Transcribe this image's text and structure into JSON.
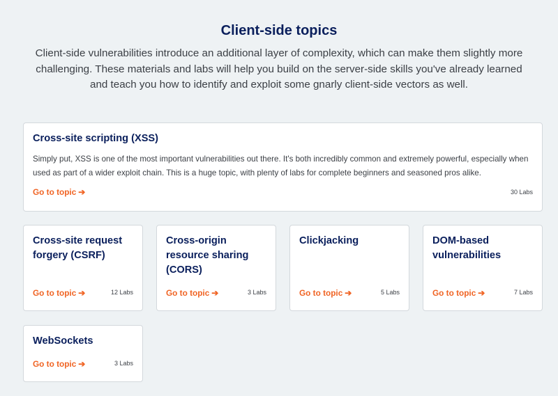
{
  "header": {
    "title": "Client-side topics",
    "intro": "Client-side vulnerabilities introduce an additional layer of complexity, which can make them slightly more challenging. These materials and labs will help you build on the server-side skills you've already learned and teach you how to identify and exploit some gnarly client-side vectors as well."
  },
  "link_arrow": "➔",
  "colors": {
    "accent": "#f06424",
    "heading": "#0a1f5c",
    "background": "#eef2f4"
  },
  "topics": [
    {
      "title": "Cross-site scripting (XSS)",
      "description": "Simply put, XSS is one of the most important vulnerabilities out there. It's both incredibly common and extremely powerful, especially when used as part of a wider exploit chain. This is a huge topic, with plenty of labs for complete beginners and seasoned pros alike.",
      "link_label": "Go to topic",
      "labs": "30 Labs"
    },
    {
      "title": "Cross-site request forgery (CSRF)",
      "link_label": "Go to topic",
      "labs": "12 Labs"
    },
    {
      "title": "Cross-origin resource sharing (CORS)",
      "link_label": "Go to topic",
      "labs": "3 Labs"
    },
    {
      "title": "Clickjacking",
      "link_label": "Go to topic",
      "labs": "5 Labs"
    },
    {
      "title": "DOM-based vulnerabilities",
      "link_label": "Go to topic",
      "labs": "7 Labs"
    },
    {
      "title": "WebSockets",
      "link_label": "Go to topic",
      "labs": "3 Labs"
    }
  ]
}
